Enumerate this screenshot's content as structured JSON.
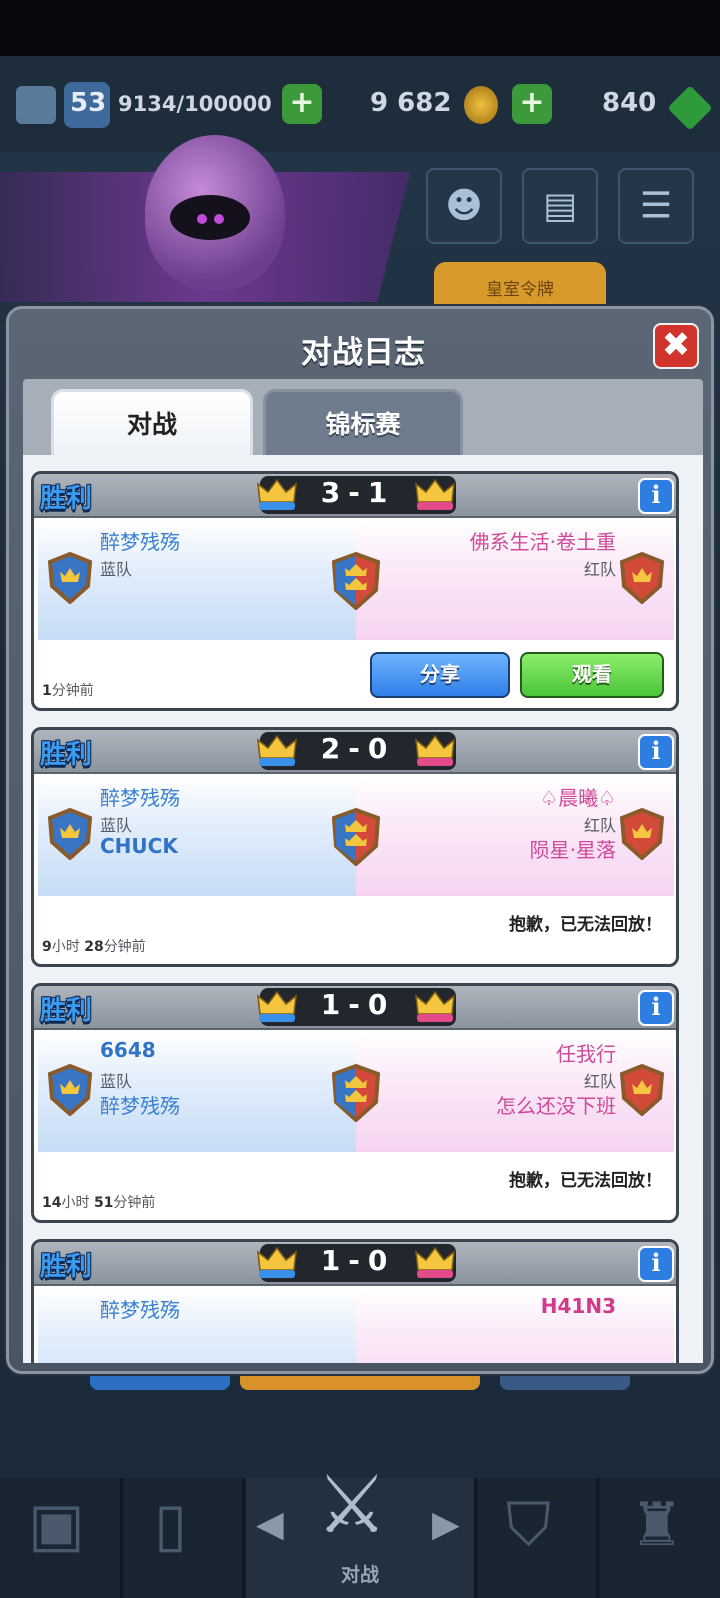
{
  "hud": {
    "level": "53",
    "xp": "9134/100000",
    "gold": "9 682",
    "gems": "840",
    "royal_pass": "皇室令牌"
  },
  "dialog": {
    "title": "对战日志",
    "close_label": "✖",
    "tabs": [
      {
        "label": "对战",
        "active": true
      },
      {
        "label": "锦标赛",
        "active": false
      }
    ]
  },
  "battles": [
    {
      "result": "胜利",
      "score_blue": "3",
      "score_red": "1",
      "blue_players": [
        "醉梦残殇"
      ],
      "blue_team": "蓝队",
      "red_players": [
        "佛系生活·卷土重"
      ],
      "red_team": "红队",
      "time_num1": "1",
      "time_unit1": "分钟前",
      "time_num2": "",
      "time_unit2": "",
      "share_label": "分享",
      "watch_label": "观看",
      "replay_msg": ""
    },
    {
      "result": "胜利",
      "score_blue": "2",
      "score_red": "0",
      "blue_players": [
        "醉梦残殇",
        "CHUCK"
      ],
      "blue_team": "蓝队",
      "red_players": [
        "♤晨曦♤",
        "陨星·星落"
      ],
      "red_team": "红队",
      "time_num1": "9",
      "time_unit1": "小时 ",
      "time_num2": "28",
      "time_unit2": "分钟前",
      "replay_msg": "抱歉，已无法回放！"
    },
    {
      "result": "胜利",
      "score_blue": "1",
      "score_red": "0",
      "blue_players": [
        "6648",
        "醉梦残殇"
      ],
      "blue_team": "蓝队",
      "red_players": [
        "任我行",
        "怎么还没下班"
      ],
      "red_team": "红队",
      "time_num1": "14",
      "time_unit1": "小时 ",
      "time_num2": "51",
      "time_unit2": "分钟前",
      "replay_msg": "抱歉，已无法回放！"
    },
    {
      "result": "胜利",
      "score_blue": "1",
      "score_red": "0",
      "blue_players": [
        "醉梦残殇"
      ],
      "red_players": [
        "H41N3"
      ]
    }
  ],
  "info_label": "i",
  "nav": {
    "battle_label": "对战"
  },
  "colors": {
    "win_blue": "#3d9bef",
    "blue_name": "#3a7fd0",
    "red_name": "#d04a9a",
    "share_button": "#2f7ee8",
    "watch_button": "#4cc43a",
    "close_button": "#d0342c"
  }
}
